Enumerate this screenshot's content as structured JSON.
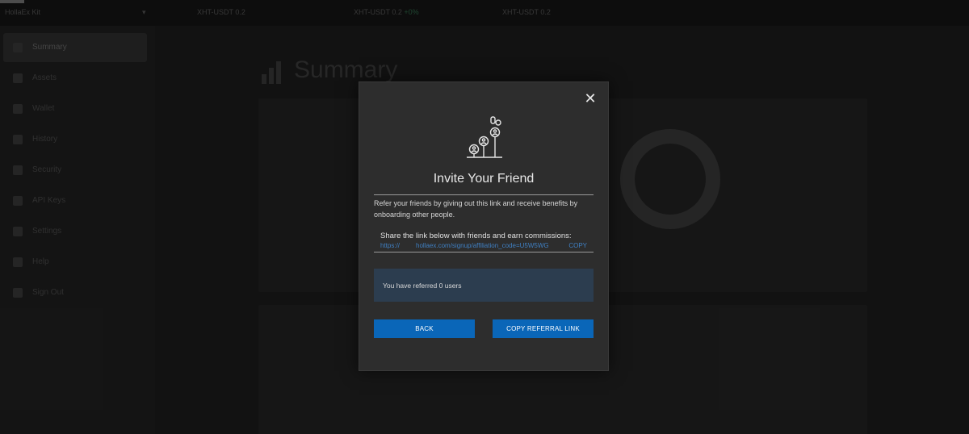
{
  "background": {
    "brand": "HollaEx Kit",
    "markets": [
      {
        "pair": "XHT-USDT",
        "price": "0.2",
        "change": ""
      },
      {
        "pair": "XHT-USDT",
        "price": "0.2",
        "change": "+0%"
      },
      {
        "pair": "XHT-USDT",
        "price": "0.2",
        "change": ""
      }
    ],
    "sidebar_items": [
      "Summary",
      "Assets",
      "Wallet",
      "History",
      "Security",
      "API Keys",
      "Settings",
      "Help",
      "Sign Out"
    ],
    "page_title": "Summary"
  },
  "modal": {
    "title": "Invite Your Friend",
    "description": "Refer your friends by giving out this link and receive benefits by onboarding other people.",
    "share_label": "Share the link below with friends and earn commissions:",
    "link_text": "https://         hollaex.com/signup/affiliation_code=U5W5WG",
    "copy_label": "COPY",
    "referred_text": "You have referred 0 users",
    "back_label": "BACK",
    "copy_referral_label": "COPY REFERRAL LINK",
    "close_icon": "close-icon",
    "graphic_icon": "invite-friends-icon"
  },
  "colors": {
    "modal_bg": "#2d2d2d",
    "accent": "#0a66b8",
    "link": "#3f7fc2",
    "referred_bg": "#2c3d4f"
  }
}
